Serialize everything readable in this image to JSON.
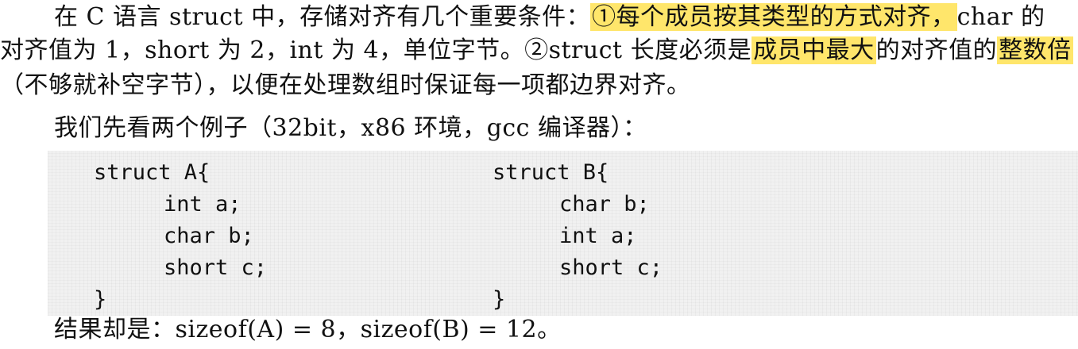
{
  "paragraph": {
    "line1": {
      "pre": "在 C 语言 struct 中，存储对齐有几个重要条件：",
      "highlight": "①每个成员按其类型的方式对齐，",
      "post": "char 的"
    },
    "line2": {
      "pre": "对齐值为 1，short 为 2，int 为 4，单位字节。②struct 长度必须是",
      "highlight1": "成员中最大",
      "mid": "的对齐值的",
      "highlight2": "整数倍"
    },
    "line3": "（不够就补空字节），以便在处理数组时保证每一项都边界对齐。"
  },
  "intro": "我们先看两个例子（32bit，x86 环境，gcc 编译器）：",
  "code": {
    "struct_a": [
      "struct A{",
      "int a;",
      "char b;",
      "short c;",
      "}"
    ],
    "struct_b": [
      "struct B{",
      "char b;",
      "int a;",
      "short c;",
      "}"
    ]
  },
  "result": "结果却是：sizeof(A) = 8，sizeof(B) = 12。",
  "colors": {
    "highlight": "#ffe66b",
    "code_background": "#f1f1f1"
  }
}
